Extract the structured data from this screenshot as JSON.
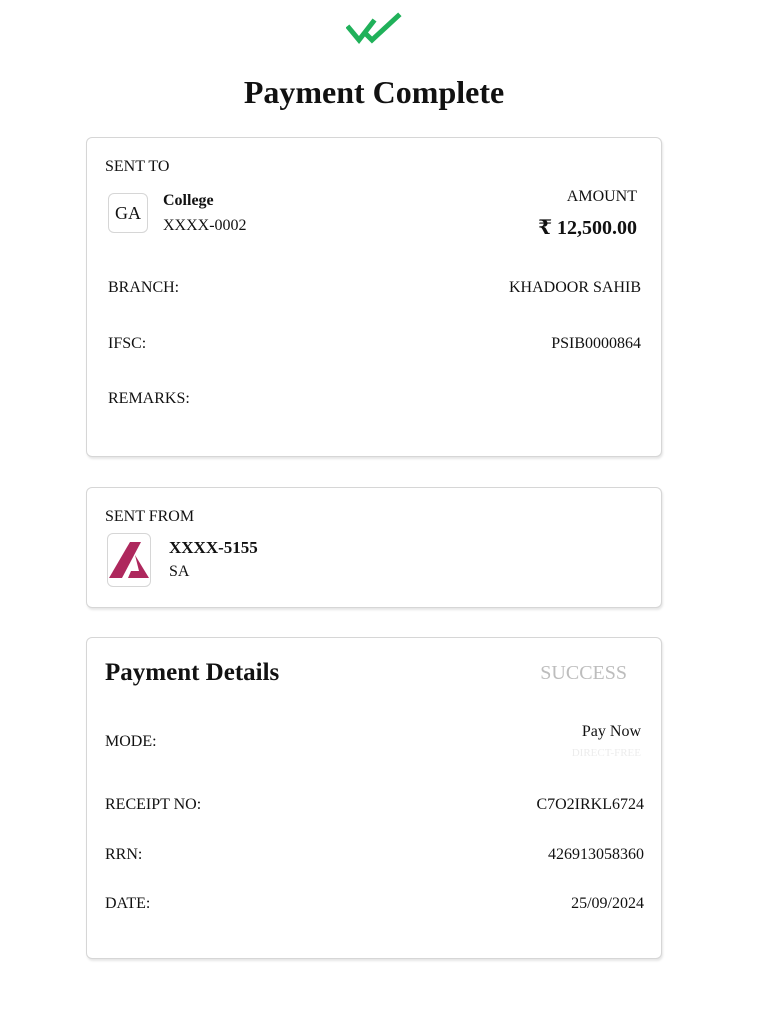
{
  "header": {
    "check_icon": "double-check-icon",
    "check_color": "#20b15a",
    "title": "Payment Complete"
  },
  "sent_to": {
    "section_label": "SENT TO",
    "avatar_initials": "GA",
    "name": "College",
    "account": "XXXX-0002",
    "amount_label": "AMOUNT",
    "amount": "₹ 12,500.00",
    "branch_label": "BRANCH:",
    "branch_value": "KHADOOR SAHIB",
    "ifsc_label": "IFSC:",
    "ifsc_value": "PSIB0000864",
    "remarks_label": "REMARKS:",
    "remarks_value": ""
  },
  "sent_from": {
    "section_label": "SENT FROM",
    "bank_logo_icon": "axis-bank-logo-icon",
    "bank_color": "#ae285d",
    "account": "XXXX-5155",
    "name": "SA"
  },
  "details": {
    "title": "Payment Details",
    "status": "SUCCESS",
    "status_color": "#bdbdbd",
    "mode_label": "MODE:",
    "mode_value": "Pay Now",
    "mode_sub": "DIRECT-FREE",
    "receipt_label": "RECEIPT NO:",
    "receipt_value": "C7O2IRKL6724",
    "rrn_label": "RRN:",
    "rrn_value": "426913058360",
    "date_label": "DATE:",
    "date_value": "25/09/2024"
  }
}
